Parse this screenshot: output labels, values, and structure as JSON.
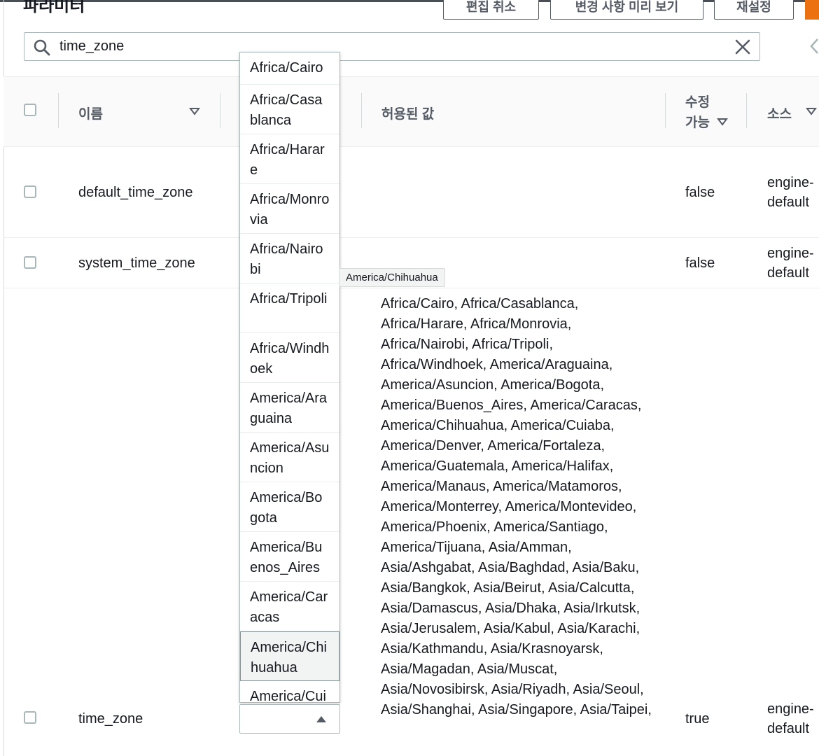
{
  "header": {
    "title": "파라미터",
    "cancel_edit": "편집 취소",
    "preview_changes": "변경 사항 미리 보기",
    "reset": "재설정"
  },
  "search": {
    "value": "time_zone"
  },
  "table": {
    "columns": {
      "name": "이름",
      "allowed": "허용된 값",
      "modifiable": "수정 가능",
      "source": "소스"
    },
    "rows": [
      {
        "name": "default_time_zone",
        "modifiable": "false",
        "source": "engine-default"
      },
      {
        "name": "system_time_zone",
        "modifiable": "false",
        "source": "engine-default"
      },
      {
        "name": "time_zone",
        "modifiable": "true",
        "source": "engine-default"
      }
    ],
    "allowed_values_text": "Africa/Cairo, Africa/Casablanca, Africa/Harare, Africa/Monrovia, Africa/Nairobi, Africa/Tripoli, Africa/Windhoek, America/Araguaina, America/Asuncion, America/Bogota, America/Buenos_Aires, America/Caracas, America/Chihuahua, America/Cuiaba, America/Denver, America/Fortaleza, America/Guatemala, America/Halifax, America/Manaus, America/Matamoros, America/Monterrey, America/Montevideo, America/Phoenix, America/Santiago, America/Tijuana, Asia/Amman, Asia/Ashgabat, Asia/Baghdad, Asia/Baku, Asia/Bangkok, Asia/Beirut, Asia/Calcutta, Asia/Damascus, Asia/Dhaka, Asia/Irkutsk, Asia/Jerusalem, Asia/Kabul, Asia/Karachi, Asia/Kathmandu, Asia/Krasnoyarsk, Asia/Magadan, Asia/Muscat, Asia/Novosibirsk, Asia/Riyadh, Asia/Seoul, Asia/Shanghai, Asia/Singapore, Asia/Taipei,"
  },
  "dropdown": {
    "options": [
      "Africa/Cairo",
      "Africa/Casablanca",
      "Africa/Harare",
      "Africa/Monrovia",
      "Africa/Nairobi",
      "Africa/Tripoli",
      "Africa/Windhoek",
      "America/Araguaina",
      "America/Asuncion",
      "America/Bogota",
      "America/Buenos_Aires",
      "America/Caracas",
      "America/Chihuahua",
      "America/Cui"
    ],
    "hovered": "America/Chihuahua",
    "tooltip": "America/Chihuahua"
  }
}
